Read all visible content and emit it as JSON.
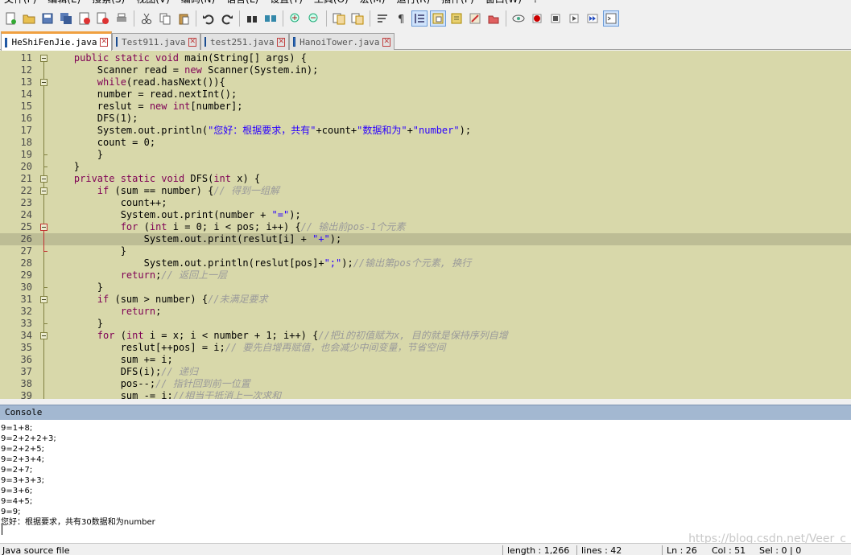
{
  "menu": [
    "文件(F)",
    "编辑(E)",
    "搜索(S)",
    "视图(V)",
    "编码(N)",
    "语言(L)",
    "设置(T)",
    "工具(O)",
    "宏(M)",
    "运行(R)",
    "插件(P)",
    "窗口(W)",
    "?"
  ],
  "toolbar_icons": [
    "new-file-icon",
    "open-file-icon",
    "save-icon",
    "save-all-icon",
    "close-icon",
    "close-all-icon",
    "print-icon",
    "cut-icon",
    "copy-icon",
    "paste-icon",
    "undo-icon",
    "redo-icon",
    "find-icon",
    "replace-icon",
    "zoom-in-icon",
    "zoom-out-icon",
    "sync-vertical-icon",
    "sync-horizontal-icon",
    "word-wrap-icon",
    "show-all-chars-icon",
    "indent-guide-icon",
    "document-map-icon",
    "function-list-icon",
    "folder-workspace-icon",
    "monitoring-icon",
    "record-macro-icon",
    "stop-record-icon",
    "play-macro-icon",
    "run-macro-multiple-icon",
    "save-macro-icon",
    "console-icon"
  ],
  "tabs": [
    {
      "label": "HeShiFenJie.java",
      "active": true
    },
    {
      "label": "Test911.java",
      "active": false
    },
    {
      "label": "test251.java",
      "active": false
    },
    {
      "label": "HanoiTower.java",
      "active": false
    }
  ],
  "editor": {
    "lines": [
      {
        "n": "11",
        "indent": "    ",
        "parts": [
          [
            "kw",
            "public static void "
          ],
          [
            "",
            "main(String[] args) {"
          ]
        ]
      },
      {
        "n": "12",
        "indent": "        ",
        "parts": [
          [
            "",
            "Scanner read = "
          ],
          [
            "kw",
            "new "
          ],
          [
            "",
            "Scanner(System.in);"
          ]
        ]
      },
      {
        "n": "13",
        "indent": "        ",
        "parts": [
          [
            "kw",
            "while"
          ],
          [
            "",
            "(read.hasNext()){"
          ]
        ]
      },
      {
        "n": "14",
        "indent": "        ",
        "parts": [
          [
            "",
            "number = read.nextInt();"
          ]
        ]
      },
      {
        "n": "15",
        "indent": "        ",
        "parts": [
          [
            "",
            "reslut = "
          ],
          [
            "kw",
            "new int"
          ],
          [
            "",
            "[number];"
          ]
        ]
      },
      {
        "n": "16",
        "indent": "        ",
        "parts": [
          [
            "",
            "DFS(1);"
          ]
        ]
      },
      {
        "n": "17",
        "indent": "        ",
        "parts": [
          [
            "",
            "System.out.println("
          ],
          [
            "st",
            "\"您好：根据要求，共有\""
          ],
          [
            "",
            "+count+"
          ],
          [
            "st",
            "\"数据和为\""
          ],
          [
            "",
            "+"
          ],
          [
            "st",
            "\"number\""
          ],
          [
            "",
            ");"
          ]
        ]
      },
      {
        "n": "18",
        "indent": "        ",
        "parts": [
          [
            "",
            "count = 0;"
          ]
        ]
      },
      {
        "n": "19",
        "indent": "        ",
        "parts": [
          [
            "",
            "}"
          ]
        ]
      },
      {
        "n": "20",
        "indent": "    ",
        "parts": [
          [
            "",
            "}"
          ]
        ]
      },
      {
        "n": "21",
        "indent": "    ",
        "parts": [
          [
            "kw",
            "private static void "
          ],
          [
            "",
            "DFS("
          ],
          [
            "kw",
            "int "
          ],
          [
            "",
            "x) {"
          ]
        ]
      },
      {
        "n": "22",
        "indent": "        ",
        "parts": [
          [
            "kw",
            "if "
          ],
          [
            "",
            "(sum == number) {"
          ],
          [
            "cm",
            "// 得到一组解"
          ]
        ]
      },
      {
        "n": "23",
        "indent": "            ",
        "parts": [
          [
            "",
            "count++;"
          ]
        ]
      },
      {
        "n": "24",
        "indent": "            ",
        "parts": [
          [
            "",
            "System.out.print(number + "
          ],
          [
            "st",
            "\"=\""
          ],
          [
            "",
            ");"
          ]
        ]
      },
      {
        "n": "25",
        "indent": "            ",
        "parts": [
          [
            "kw",
            "for "
          ],
          [
            "",
            "("
          ],
          [
            "kw",
            "int "
          ],
          [
            "",
            "i = 0; i < pos; i++) {"
          ],
          [
            "cm",
            "// 输出前pos-1个元素"
          ]
        ]
      },
      {
        "n": "26",
        "indent": "                ",
        "parts": [
          [
            "",
            "System.out.print(reslut[i] + "
          ],
          [
            "st",
            "\"+\""
          ],
          [
            "",
            ");"
          ]
        ]
      },
      {
        "n": "27",
        "indent": "            ",
        "parts": [
          [
            "",
            "}"
          ]
        ]
      },
      {
        "n": "28",
        "indent": "                ",
        "parts": [
          [
            "",
            "System.out.println(reslut[pos]+"
          ],
          [
            "st",
            "\";\""
          ],
          [
            "",
            ");"
          ],
          [
            "cm",
            "//输出第pos个元素, 换行"
          ]
        ]
      },
      {
        "n": "29",
        "indent": "            ",
        "parts": [
          [
            "kw",
            "return"
          ],
          [
            "",
            ";"
          ],
          [
            "cm",
            "// 返回上一层"
          ]
        ]
      },
      {
        "n": "30",
        "indent": "        ",
        "parts": [
          [
            "",
            "}"
          ]
        ]
      },
      {
        "n": "31",
        "indent": "        ",
        "parts": [
          [
            "kw",
            "if "
          ],
          [
            "",
            "(sum > number) {"
          ],
          [
            "cm",
            "//未满足要求"
          ]
        ]
      },
      {
        "n": "32",
        "indent": "            ",
        "parts": [
          [
            "kw",
            "return"
          ],
          [
            "",
            ";"
          ]
        ]
      },
      {
        "n": "33",
        "indent": "        ",
        "parts": [
          [
            "",
            "}"
          ]
        ]
      },
      {
        "n": "34",
        "indent": "        ",
        "parts": [
          [
            "kw",
            "for "
          ],
          [
            "",
            "("
          ],
          [
            "kw",
            "int "
          ],
          [
            "",
            "i = x; i < number + 1; i++) {"
          ],
          [
            "cm",
            "//把i的初值赋为x, 目的就是保持序列自增"
          ]
        ]
      },
      {
        "n": "35",
        "indent": "            ",
        "parts": [
          [
            "",
            "reslut[++pos] = i;"
          ],
          [
            "cm",
            "// 要先自增再赋值，也会减少中间变量，节省空间"
          ]
        ]
      },
      {
        "n": "36",
        "indent": "            ",
        "parts": [
          [
            "",
            "sum += i;"
          ]
        ]
      },
      {
        "n": "37",
        "indent": "            ",
        "parts": [
          [
            "",
            "DFS(i);"
          ],
          [
            "cm",
            "// 递归"
          ]
        ]
      },
      {
        "n": "38",
        "indent": "            ",
        "parts": [
          [
            "",
            "pos--;"
          ],
          [
            "cm",
            "// 指针回到前一位置"
          ]
        ]
      },
      {
        "n": "39",
        "indent": "            ",
        "parts": [
          [
            "",
            "sum -= i;"
          ],
          [
            "cm",
            "//相当于抵消上一次求和"
          ]
        ]
      }
    ],
    "current_line": "26"
  },
  "console": {
    "title": "Console",
    "output": [
      "9=1+8;",
      "9=2+2+2+3;",
      "9=2+2+5;",
      "9=2+3+4;",
      "9=2+7;",
      "9=3+3+3;",
      "9=3+6;",
      "9=4+5;",
      "9=9;",
      "您好：根据要求，共有30数据和为number"
    ],
    "watermark": "https://blog.csdn.net/Veer_c"
  },
  "status": {
    "file_type": "Java source file",
    "length": "length : 1,266",
    "lines": "lines : 42",
    "ln": "Ln : 26",
    "col": "Col : 51",
    "sel": "Sel : 0 | 0"
  },
  "colors": {
    "editor_bg": "#d8d8aa",
    "current_line": "#bdbd95",
    "keyword": "#7f0055",
    "string": "#2a00ff",
    "comment": "#9a9a9a",
    "console_header": "#a3b8d1",
    "active_tab_accent": "#f0a040"
  }
}
